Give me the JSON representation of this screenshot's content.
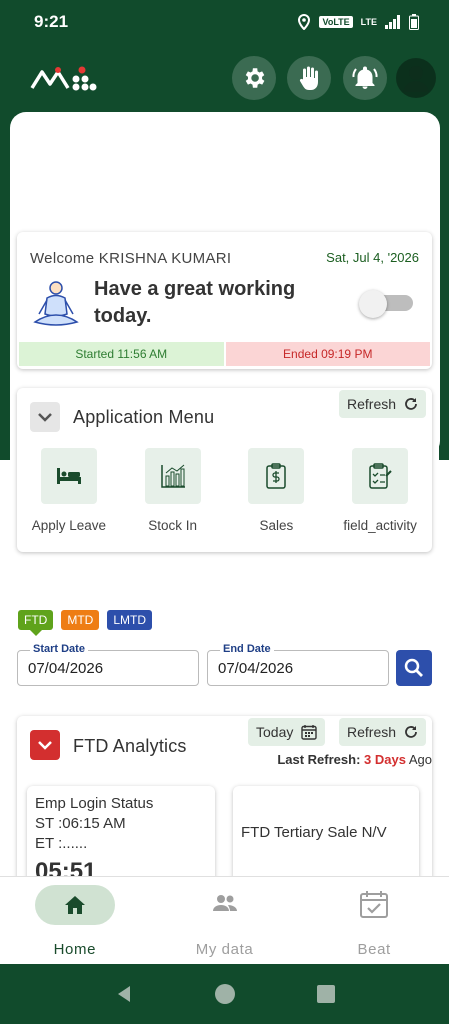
{
  "status_bar": {
    "time": "9:21",
    "volte": "VoLTE",
    "lte": "LTE"
  },
  "welcome": {
    "text": "Welcome KRISHNA KUMARI",
    "date": "Sat, Jul 4, '2026",
    "greeting": "Have a great working today.",
    "started": "Started 11:56 AM",
    "ended": "Ended 09:19 PM"
  },
  "app_menu": {
    "title": "Application Menu",
    "refresh": "Refresh",
    "items": [
      {
        "label": "Apply Leave",
        "icon": "bed-icon"
      },
      {
        "label": "Stock In",
        "icon": "bar-chart-icon"
      },
      {
        "label": "Sales",
        "icon": "clipboard-icon"
      },
      {
        "label": "field_activity",
        "icon": "checklist-icon"
      }
    ]
  },
  "period_tabs": [
    "FTD",
    "MTD",
    "LMTD"
  ],
  "filters": {
    "start_label": "Start Date",
    "start_value": "07/04/2026",
    "end_label": "End Date",
    "end_value": "07/04/2026"
  },
  "ftd": {
    "title": "FTD Analytics",
    "today": "Today",
    "refresh": "Refresh",
    "last_refresh_label": "Last Refresh:",
    "last_refresh_days": "3 Days",
    "last_refresh_suffix": "Ago",
    "emp_login": {
      "title": "Emp Login Status",
      "st": "ST :06:15 AM",
      "et": "ET :......",
      "time": "05:51"
    },
    "tertiary": "FTD Tertiary Sale N/V"
  },
  "bottom_nav": [
    {
      "label": "Home",
      "icon": "home-icon"
    },
    {
      "label": "My data",
      "icon": "people-icon"
    },
    {
      "label": "Beat",
      "icon": "calendar-check-icon"
    }
  ],
  "colors": {
    "primary": "#114b2c",
    "accent_blue": "#2d4fab",
    "ftd_green": "#5fa31b",
    "mtd_orange": "#ee7d14",
    "danger": "#d32f2f"
  }
}
